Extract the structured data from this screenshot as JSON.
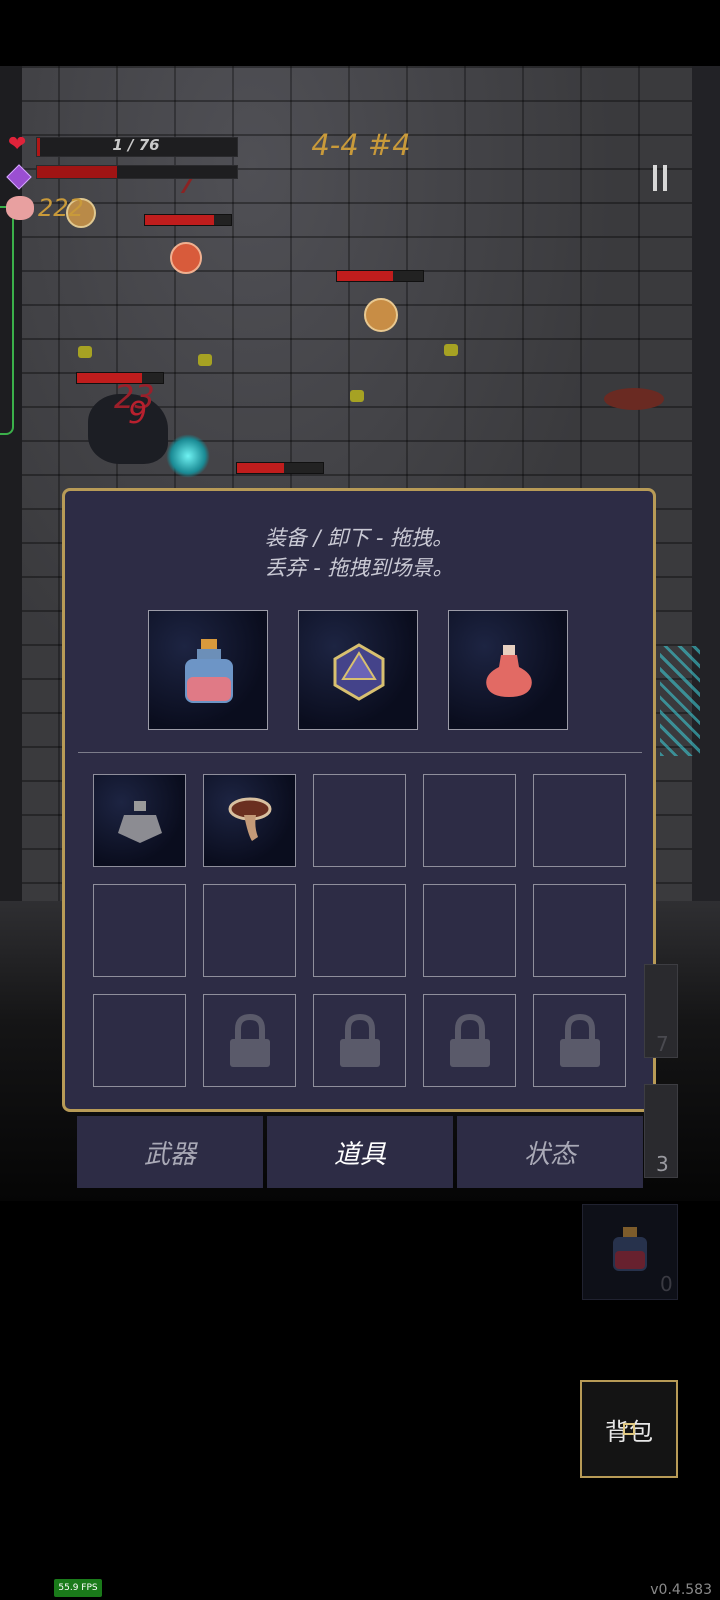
{
  "hud": {
    "hp_text": "1 / 76",
    "hp_fraction": 0.013,
    "mana_fraction": 0.5,
    "coins": "222",
    "level": "4-4 #4",
    "pause_icon": "pause-icon"
  },
  "damage_numbers": [
    "7",
    "23",
    "9"
  ],
  "inventory_panel": {
    "hint_line1": "装备 / 卸下 - 拖拽。",
    "hint_line2": "丢弃 - 拖拽到场景。",
    "equipped": [
      {
        "icon": "blue-potion-icon"
      },
      {
        "icon": "d20-dice-icon"
      },
      {
        "icon": "red-flask-icon"
      }
    ],
    "slots_row1": [
      {
        "icon": "grenade-icon",
        "locked": false
      },
      {
        "icon": "scroll-icon",
        "locked": false
      },
      {
        "icon": "",
        "locked": false
      },
      {
        "icon": "",
        "locked": false
      },
      {
        "icon": "",
        "locked": false
      }
    ],
    "slots_row2": [
      {
        "icon": "",
        "locked": false
      },
      {
        "icon": "",
        "locked": false
      },
      {
        "icon": "",
        "locked": false
      },
      {
        "icon": "",
        "locked": false
      },
      {
        "icon": "",
        "locked": false
      }
    ],
    "slots_row3": [
      {
        "icon": "",
        "locked": false
      },
      {
        "icon": "lock-icon",
        "locked": true
      },
      {
        "icon": "lock-icon",
        "locked": true
      },
      {
        "icon": "lock-icon",
        "locked": true
      },
      {
        "icon": "lock-icon",
        "locked": true
      }
    ]
  },
  "tabs": [
    {
      "label": "武器",
      "active": false
    },
    {
      "label": "道具",
      "active": true
    },
    {
      "label": "状态",
      "active": false
    }
  ],
  "quick_slots": {
    "partial_count_a": "7",
    "partial_count_b": "3",
    "potion_count": "0"
  },
  "bag_button": "背包",
  "fps": "55.9 FPS",
  "version": "v0.4.583",
  "colors": {
    "panel_bg": "#2d2c45",
    "panel_border": "#b89b57",
    "health_red": "#b11616",
    "level_text": "#c99a3a"
  }
}
